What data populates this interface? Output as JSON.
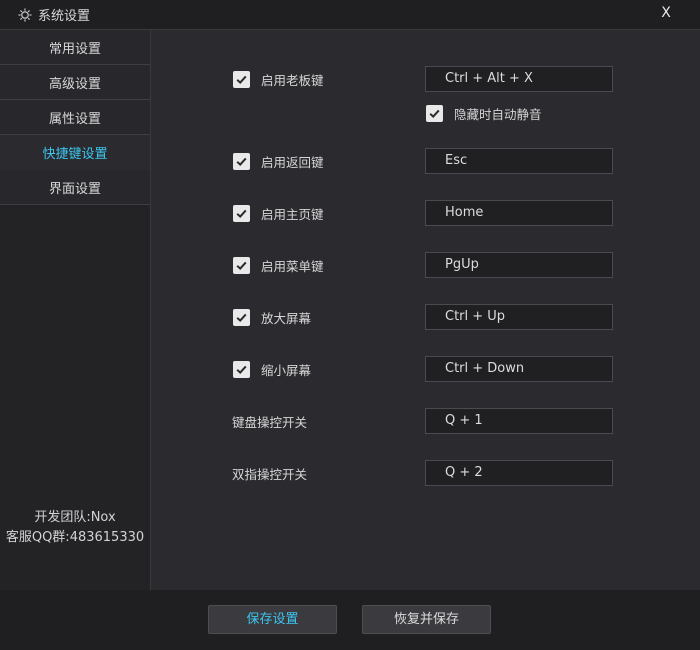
{
  "window": {
    "title": "系统设置",
    "close_label": "X"
  },
  "sidebar": {
    "items": [
      {
        "label": "常用设置"
      },
      {
        "label": "高级设置"
      },
      {
        "label": "属性设置"
      },
      {
        "label": "快捷键设置",
        "active": true
      },
      {
        "label": "界面设置"
      }
    ],
    "info_team": "开发团队:Nox",
    "info_qq": "客服QQ群:483615330"
  },
  "shortcuts": {
    "boss_key": {
      "label": "启用老板键",
      "checked": true,
      "key": "Ctrl + Alt + X"
    },
    "mute_on_hide": {
      "label": "隐藏时自动静音",
      "checked": true
    },
    "back_key": {
      "label": "启用返回键",
      "checked": true,
      "key": "Esc"
    },
    "home_key": {
      "label": "启用主页键",
      "checked": true,
      "key": "Home"
    },
    "menu_key": {
      "label": "启用菜单键",
      "checked": true,
      "key": "PgUp"
    },
    "zoom_in": {
      "label": "放大屏幕",
      "checked": true,
      "key": "Ctrl + Up"
    },
    "zoom_out": {
      "label": "缩小屏幕",
      "checked": true,
      "key": "Ctrl + Down"
    },
    "keyboard_control": {
      "label": "键盘操控开关",
      "key": "Q + 1"
    },
    "two_finger_control": {
      "label": "双指操控开关",
      "key": "Q + 2"
    }
  },
  "footer": {
    "save_label": "保存设置",
    "restore_label": "恢复并保存"
  },
  "colors": {
    "accent": "#3cc6ef",
    "background": "#2b2b2f",
    "sidebar": "#232326",
    "titlebar": "#1f1f22"
  }
}
